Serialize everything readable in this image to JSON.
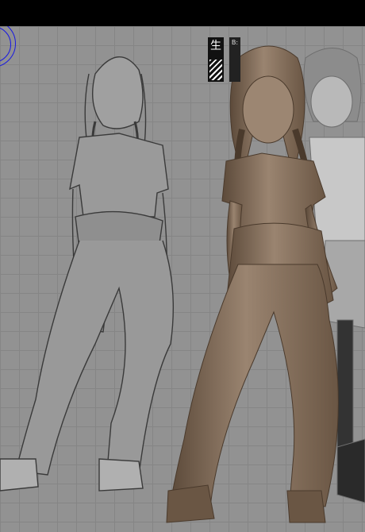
{
  "badge": {
    "char": "生",
    "small_text": "B:"
  },
  "colors": {
    "titlebar": "#000000",
    "viewport_bg": "#929292",
    "grid": "#858585",
    "gizmo": "#1a1ae0",
    "sketch_line": "#3a3a3a",
    "model_clay": "#8d7761",
    "model_shadow": "#5c4a3a",
    "background_model": "#b9b9b9"
  },
  "icons": {
    "orientation_gizmo": "transform-gizmo-icon"
  }
}
